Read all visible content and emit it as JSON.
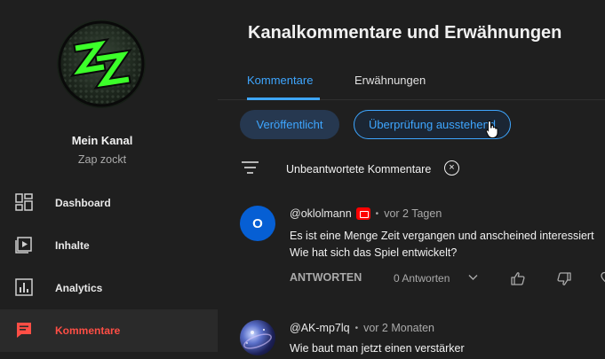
{
  "sidebar": {
    "channel_name": "Mein Kanal",
    "channel_handle": "Zap zockt",
    "items": [
      {
        "label": "Dashboard",
        "icon": "dashboard-icon"
      },
      {
        "label": "Inhalte",
        "icon": "content-icon"
      },
      {
        "label": "Analytics",
        "icon": "analytics-icon"
      },
      {
        "label": "Kommentare",
        "icon": "comments-icon",
        "active": true
      }
    ]
  },
  "main": {
    "title": "Kanalkommentare und Erwähnungen",
    "tabs": [
      {
        "label": "Kommentare",
        "active": true
      },
      {
        "label": "Erwähnungen",
        "active": false
      }
    ],
    "chips": [
      {
        "label": "Veröffentlicht",
        "selected": false
      },
      {
        "label": "Überprüfung ausstehend",
        "selected": true
      }
    ],
    "filter": {
      "label": "Unbeantwortete Kommentare",
      "clear_symbol": "×"
    }
  },
  "comments": [
    {
      "avatar_letter": "O",
      "author": "@oklolmann",
      "separator": "•",
      "time": "vor 2 Tagen",
      "text_lines": [
        "Es ist eine Menge Zeit vergangen und anscheined interessiert",
        "Wie hat sich das Spiel entwickelt?"
      ],
      "reply_label": "ANTWORTEN",
      "replies_label": "0 Antworten"
    },
    {
      "author": "@AK-mp7lq",
      "separator": "•",
      "time": "vor 2 Monaten",
      "text_lines": [
        "Wie baut man jetzt einen verstärker"
      ]
    }
  ],
  "colors": {
    "background": "#1f1f1f",
    "accent_blue": "#3ea6ff",
    "active_red": "#ff4e45",
    "avatar_blue": "#065fd4",
    "logo_green": "#39ff14"
  }
}
